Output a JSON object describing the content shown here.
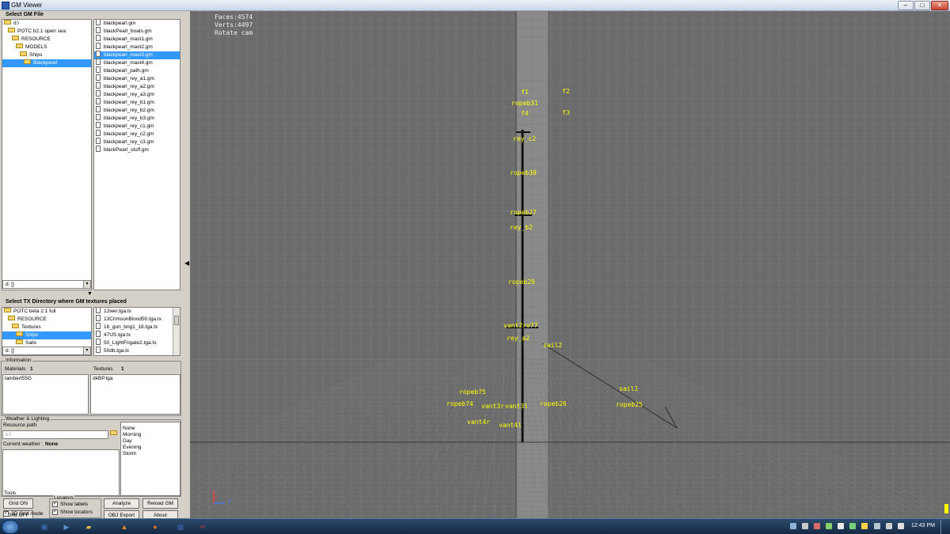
{
  "window": {
    "title": "GM Viewer",
    "controls": {
      "minimize": "–",
      "maximize": "□",
      "close": "✕"
    }
  },
  "gm_file": {
    "heading": "Select GM File",
    "folders": [
      {
        "label": "d:\\",
        "indent": 0,
        "selected": false
      },
      {
        "label": "POTC b2.1 open sea",
        "indent": 1,
        "selected": false
      },
      {
        "label": "RESOURCE",
        "indent": 2,
        "selected": false
      },
      {
        "label": "MODELS",
        "indent": 3,
        "selected": false
      },
      {
        "label": "Ships",
        "indent": 4,
        "selected": false
      },
      {
        "label": "Blackpearl",
        "indent": 5,
        "selected": true
      }
    ],
    "files": [
      {
        "label": "blackpearl.gm",
        "selected": false
      },
      {
        "label": "blackPearl_boats.gm",
        "selected": false
      },
      {
        "label": "blackpearl_mast1.gm",
        "selected": false
      },
      {
        "label": "blackpearl_mast2.gm",
        "selected": false
      },
      {
        "label": "blackpearl_mast3.gm",
        "selected": true
      },
      {
        "label": "blackpearl_mast4.gm",
        "selected": false
      },
      {
        "label": "blackpearl_path.gm",
        "selected": false
      },
      {
        "label": "blackpearl_rey_a1.gm",
        "selected": false
      },
      {
        "label": "blackpearl_rey_a2.gm",
        "selected": false
      },
      {
        "label": "blackpearl_rey_a3.gm",
        "selected": false
      },
      {
        "label": "blackpearl_rey_b1.gm",
        "selected": false
      },
      {
        "label": "blackpearl_rey_b2.gm",
        "selected": false
      },
      {
        "label": "blackpearl_rey_b3.gm",
        "selected": false
      },
      {
        "label": "blackpearl_rey_c1.gm",
        "selected": false
      },
      {
        "label": "blackpearl_rey_c2.gm",
        "selected": false
      },
      {
        "label": "blackpearl_rey_c3.gm",
        "selected": false
      },
      {
        "label": "blackPearl_stuff.gm",
        "selected": false
      }
    ],
    "drive": "d: []"
  },
  "tx_dir": {
    "heading": "Select TX Directory where GM textures placed",
    "folders": [
      {
        "label": "POTC beta 2.1 full",
        "indent": 0,
        "selected": false
      },
      {
        "label": "RESOURCE",
        "indent": 1,
        "selected": false
      },
      {
        "label": "Textures",
        "indent": 2,
        "selected": false
      },
      {
        "label": "Ships",
        "indent": 3,
        "selected": true
      },
      {
        "label": "Sails",
        "indent": 3,
        "selected": false
      }
    ],
    "files": [
      {
        "label": "12wer.tga.tx",
        "selected": false
      },
      {
        "label": "13CrimsonBlood50.tga.tx",
        "selected": false
      },
      {
        "label": "16_gun_brig1_18.tga.tx",
        "selected": false
      },
      {
        "label": "47US.tga.tx",
        "selected": false
      },
      {
        "label": "50_LightFrigate2.tga.tx",
        "selected": false
      },
      {
        "label": "50db.tga.tx",
        "selected": false
      }
    ],
    "drive": "d: []"
  },
  "information": {
    "legend": "Information",
    "materials_label": "Materials",
    "materials_count": "1",
    "textures_label": "Textures",
    "textures_count": "1",
    "material_item": "lambert55G",
    "texture_item": "dkBP.tga"
  },
  "weather": {
    "legend": "Weather & Lighting",
    "resource_path_label": "Resource path",
    "resource_path_value": "c:\\",
    "current_weather_label": "Current weather :",
    "current_weather_value": "None",
    "options": [
      "None",
      "Morning",
      "Day",
      "Evening",
      "Storm"
    ]
  },
  "tools": {
    "legend": "Tools",
    "grid_on": "Grid ON",
    "grid_off": "Grid OFF",
    "grid3d_label": "3D Grid mode",
    "grid3d_checked": true,
    "locators_legend": "Locators",
    "show_labels": "Show labels",
    "show_labels_checked": true,
    "show_locators": "Show locators",
    "show_locators_checked": true,
    "analyze": "Analyze",
    "reload": "Reload GM",
    "obj_export": "OBJ Export",
    "about": "About"
  },
  "viewport": {
    "stats": [
      "Faces:4574",
      "Verts:4497",
      "Rotate cam"
    ],
    "locators": [
      "f1",
      "f2",
      "ropeb31",
      "f4",
      "f3",
      "rey_c2",
      "ropeb30",
      "ropeb27",
      "rey_b2",
      "ropeb29",
      "vant2ro77",
      "rey_a2",
      "sail2",
      "sail1",
      "ropeb75",
      "ropeb74",
      "vant3r",
      "vant3l",
      "ropeb26",
      "ropeb25",
      "vant4r",
      "vant4l"
    ],
    "axis_labels": {
      "y": "Y",
      "z": "Z"
    }
  },
  "taskbar": {
    "apps": [
      "explorer-icon",
      "media-icon",
      "folder-icon",
      "vlc-icon",
      "firefox-icon",
      "gmviewer-icon",
      "tool-icon"
    ],
    "clock": "12:43 PM"
  },
  "colors": {
    "selection": "#3399ff",
    "locator": "#ffff00",
    "viewport_bg": "#6b6b6b"
  }
}
